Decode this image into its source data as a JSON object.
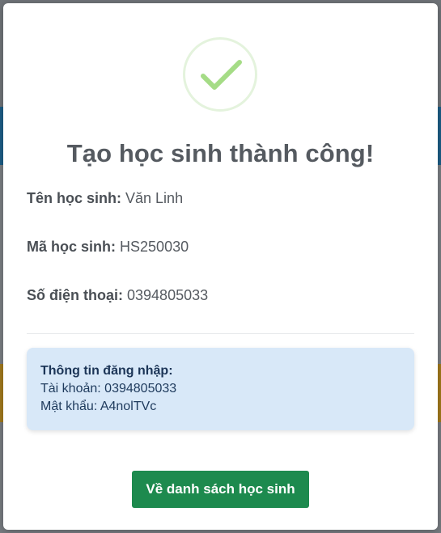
{
  "modal": {
    "title": "Tạo học sinh thành công!",
    "student_name_label": "Tên học sinh:",
    "student_name_value": "Văn Linh",
    "student_code_label": "Mã học sinh:",
    "student_code_value": "HS250030",
    "phone_label": "Số điện thoại:",
    "phone_value": "0394805033",
    "login_info": {
      "heading": "Thông tin đăng nhập:",
      "account_label": "Tài khoản:",
      "account_value": "0394805033",
      "password_label": "Mật khẩu:",
      "password_value": "A4nolTVc"
    },
    "back_button_label": "Về danh sách học sinh"
  },
  "icons": {
    "success": "check-circle-icon"
  },
  "colors": {
    "success_icon_ring": "#e4f3dd",
    "success_check": "#a5dc86",
    "primary_button": "#1d8a4e",
    "info_box_bg": "#d8e8f8",
    "overlay": "#6f7378"
  }
}
